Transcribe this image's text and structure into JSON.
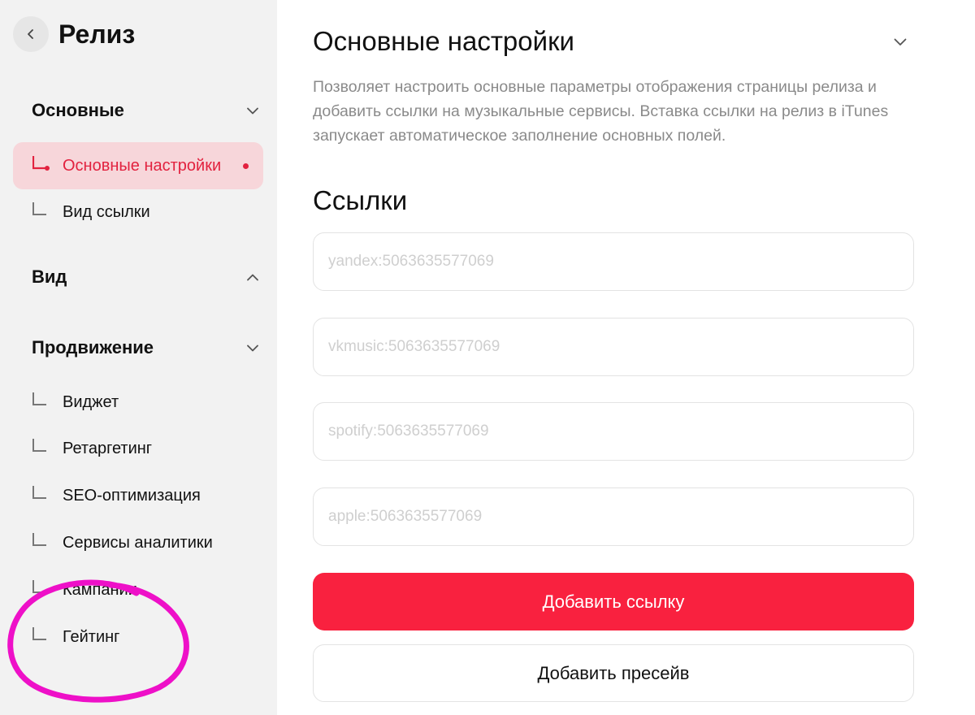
{
  "sidebar": {
    "title": "Релиз",
    "sections": [
      {
        "label": "Основные",
        "expanded": true,
        "items": [
          {
            "label": "Основные настройки",
            "active": true
          },
          {
            "label": "Вид ссылки",
            "active": false
          }
        ]
      },
      {
        "label": "Вид",
        "expanded": false,
        "items": []
      },
      {
        "label": "Продвижение",
        "expanded": true,
        "items": [
          {
            "label": "Виджет"
          },
          {
            "label": "Ретаргетинг"
          },
          {
            "label": "SEO-оптимизация"
          },
          {
            "label": "Сервисы аналитики"
          },
          {
            "label": "Кампании"
          },
          {
            "label": "Гейтинг"
          }
        ]
      }
    ]
  },
  "main": {
    "title": "Основные настройки",
    "description": "Позволяет настроить основные параметры отображения страницы релиза и добавить ссылки на музыкальные сервисы. Вставка ссылки на релиз в iTunes запускает автоматическое заполнение основных полей.",
    "links_title": "Ссылки",
    "links": [
      {
        "value": "",
        "placeholder": "yandex:5063635577069"
      },
      {
        "value": "",
        "placeholder": "vkmusic:5063635577069"
      },
      {
        "value": "",
        "placeholder": "spotify:5063635577069"
      },
      {
        "value": "",
        "placeholder": "apple:5063635577069"
      }
    ],
    "add_link_button": "Добавить ссылку",
    "add_presave_button": "Добавить пресейв"
  },
  "colors": {
    "accent": "#f9213f",
    "active_bg": "#f7d6da",
    "annotation": "#ee10c8"
  }
}
